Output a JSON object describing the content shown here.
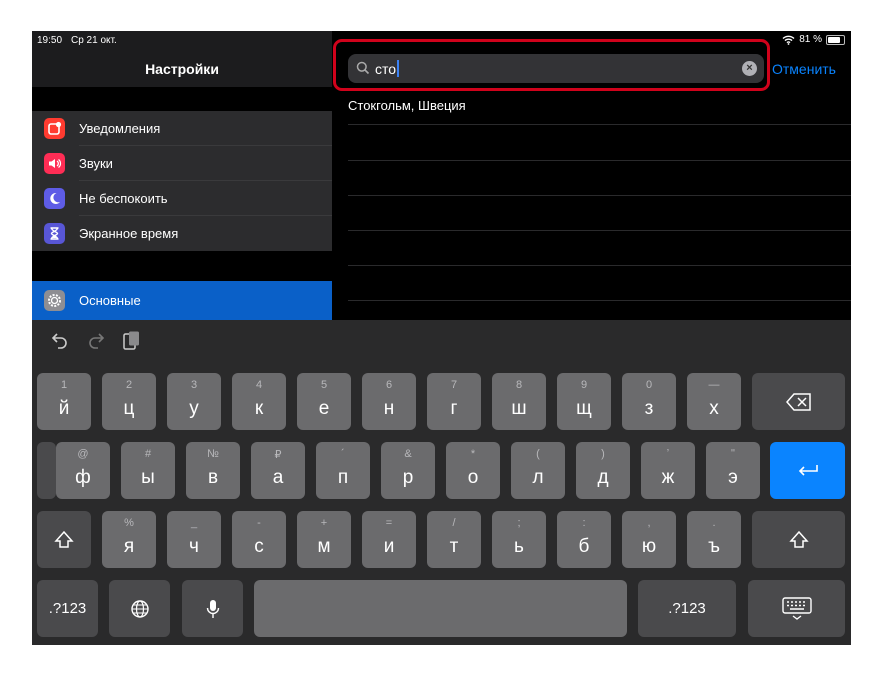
{
  "status_bar": {
    "time": "19:50",
    "date": "Ср 21 окт.",
    "battery": "81 %",
    "battery_level": 0.81
  },
  "sidebar": {
    "title": "Настройки",
    "items": [
      {
        "label": "Уведомления",
        "icon": "notifications-icon",
        "color": "#ff3b30"
      },
      {
        "label": "Звуки",
        "icon": "speaker-icon",
        "color": "#ff2d55"
      },
      {
        "label": "Не беспокоить",
        "icon": "moon-icon",
        "color": "#5e5ce6"
      },
      {
        "label": "Экранное время",
        "icon": "hourglass-icon",
        "color": "#5856d6"
      },
      {
        "label": "Основные",
        "icon": "gear-icon",
        "color": "#8e8e93",
        "selected": true
      }
    ]
  },
  "search": {
    "value": "сто",
    "cancel_label": "Отменить"
  },
  "results": [
    {
      "label": "Стокгольм, Швеция"
    }
  ],
  "keyboard": {
    "rows": [
      [
        {
          "alt": "1",
          "main": "й"
        },
        {
          "alt": "2",
          "main": "ц"
        },
        {
          "alt": "3",
          "main": "у"
        },
        {
          "alt": "4",
          "main": "к"
        },
        {
          "alt": "5",
          "main": "е"
        },
        {
          "alt": "6",
          "main": "н"
        },
        {
          "alt": "7",
          "main": "г"
        },
        {
          "alt": "8",
          "main": "ш"
        },
        {
          "alt": "9",
          "main": "щ"
        },
        {
          "alt": "0",
          "main": "з"
        },
        {
          "alt": "—",
          "main": "х"
        }
      ],
      [
        {
          "alt": "@",
          "main": "ф"
        },
        {
          "alt": "#",
          "main": "ы"
        },
        {
          "alt": "№",
          "main": "в"
        },
        {
          "alt": "₽",
          "main": "а"
        },
        {
          "alt": "´",
          "main": "п"
        },
        {
          "alt": "&",
          "main": "р"
        },
        {
          "alt": "*",
          "main": "о"
        },
        {
          "alt": "(",
          "main": "л"
        },
        {
          "alt": ")",
          "main": "д"
        },
        {
          "alt": "ʼ",
          "main": "ж"
        },
        {
          "alt": "ʺ",
          "main": "э"
        }
      ],
      [
        {
          "alt": "%",
          "main": "я"
        },
        {
          "alt": "_",
          "main": "ч"
        },
        {
          "alt": "-",
          "main": "с"
        },
        {
          "alt": "+",
          "main": "м"
        },
        {
          "alt": "=",
          "main": "и"
        },
        {
          "alt": "/",
          "main": "т"
        },
        {
          "alt": ";",
          "main": "ь"
        },
        {
          "alt": ":",
          "main": "б"
        },
        {
          "alt": ",",
          "main": "ю"
        },
        {
          "alt": ".",
          "main": "ъ"
        }
      ]
    ],
    "numbers_label": ".?123",
    "accent_color": "#0a84ff"
  }
}
